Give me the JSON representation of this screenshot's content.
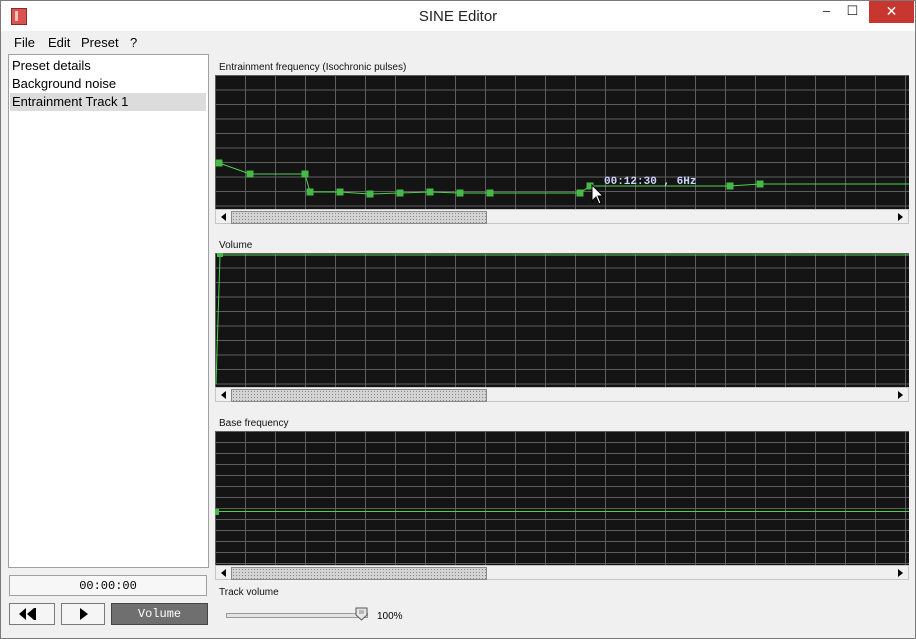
{
  "window": {
    "title": "SINE Editor"
  },
  "menu": {
    "items": [
      "File",
      "Edit",
      "Preset",
      "?"
    ]
  },
  "sidebar": {
    "items": [
      {
        "label": "Preset details",
        "selected": false
      },
      {
        "label": "Background noise",
        "selected": false
      },
      {
        "label": "Entrainment Track 1",
        "selected": true
      }
    ]
  },
  "transport": {
    "time": "00:00:00",
    "volume_label": "Volume"
  },
  "graphs": {
    "entrainment": {
      "label": "Entrainment frequency (Isochronic pulses)",
      "tooltip": "00:12:30 , 6Hz"
    },
    "volume": {
      "label": "Volume"
    },
    "base": {
      "label": "Base frequency"
    }
  },
  "track_volume": {
    "label": "Track volume",
    "value_text": "100%",
    "value": 1.0
  },
  "colors": {
    "graph_bg": "#141414",
    "grid": "#5e5e5e",
    "line": "#4fd14f",
    "point": "#46b946",
    "tooltip": "#cfd4ff"
  }
}
